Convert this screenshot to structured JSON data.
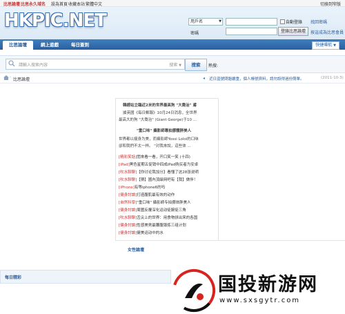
{
  "topbar": {
    "links": [
      "比思論壇",
      "比思永久域名",
      "設為首頁",
      "收藏本站",
      "繁體中文"
    ],
    "switch_style": "切換到窄版"
  },
  "header": {
    "logo": "HKPIC.NET",
    "username_select": "用戶名",
    "auto_login": "自動登錄",
    "find_password": "找回密碼",
    "password_label": "密碼",
    "login_button": "登錄比思論壇",
    "register_link": "按這成為比思會員"
  },
  "nav": {
    "tabs": [
      "比思論壇",
      "網上遊戲",
      "每日簽到"
    ],
    "quick_nav": "快捷導航"
  },
  "search": {
    "placeholder": "請輸入搜索內容",
    "scope": "搜索",
    "button": "搜索",
    "hot_label": "熱搜:"
  },
  "breadcrumb": {
    "current": "比思論壇",
    "notice": "近日盜號問題嚴重，個人帳號資料，請勿設得過份簡單。",
    "date": "(2011-10-3)"
  },
  "content": {
    "headline": "韓經站立臨近2米的世界最高狗 \"大喬治\" 鳶",
    "p1_l1": "據英國《每日郵報》10月24日消息，全世界",
    "p1_l2": "最高大的狗 \"大喬治\" (Giant George)于10 ...",
    "sub_headline": "\"重口味\" 攝影師專拍挪體胖美人",
    "p2_l1": "世界都以瘦身为美，而攝影師Yossi Loloi的口味",
    "p2_l2": "卻和我們不太一样。 \"对我來說，這些体 ...",
    "news": [
      {
        "tag": "[精彩笑話]",
        "text": "閨來看一看，开口笑一笑 (十四)"
      },
      {
        "tag": "[iPad]",
        "text": "黑色星期五促销中四成iPad购买者为安卓"
      },
      {
        "tag": "[吹水聊聊]",
        "text": "【你讨论我加分】看懂了这28张说明"
      },
      {
        "tag": "[吹水聊聊]",
        "text": "【猜】國內頂級网吧有【我】做伴！"
      },
      {
        "tag": "[iPhone]",
        "text": "有等iphone6的吗"
      },
      {
        "tag": "[健身討論]",
        "text": "打造腹肌最有效的动作"
      },
      {
        "tag": "[自然科學]",
        "text": "\"重口味\" 攝影師专拍挪体胖美人"
      },
      {
        "tag": "[健身討論]",
        "text": "周圍反覆深化运动徒腕徒三角"
      },
      {
        "tag": "[吹水聊聊]",
        "text": "舌尖上的世界：用食物拼出来的各国"
      },
      {
        "tag": "[健身討論]",
        "text": "性感美男最腰腹锻炼三组计划"
      },
      {
        "tag": "[健身討論]",
        "text": "健美运动中的水"
      }
    ]
  },
  "section2": {
    "title": "女性論壇"
  },
  "daily": {
    "title": "每日精彩"
  },
  "watermark": {
    "brand": "国投新游网",
    "url": "www.sxsgytr.com",
    "colors": {
      "red": "#d8241f",
      "black": "#111111"
    }
  }
}
